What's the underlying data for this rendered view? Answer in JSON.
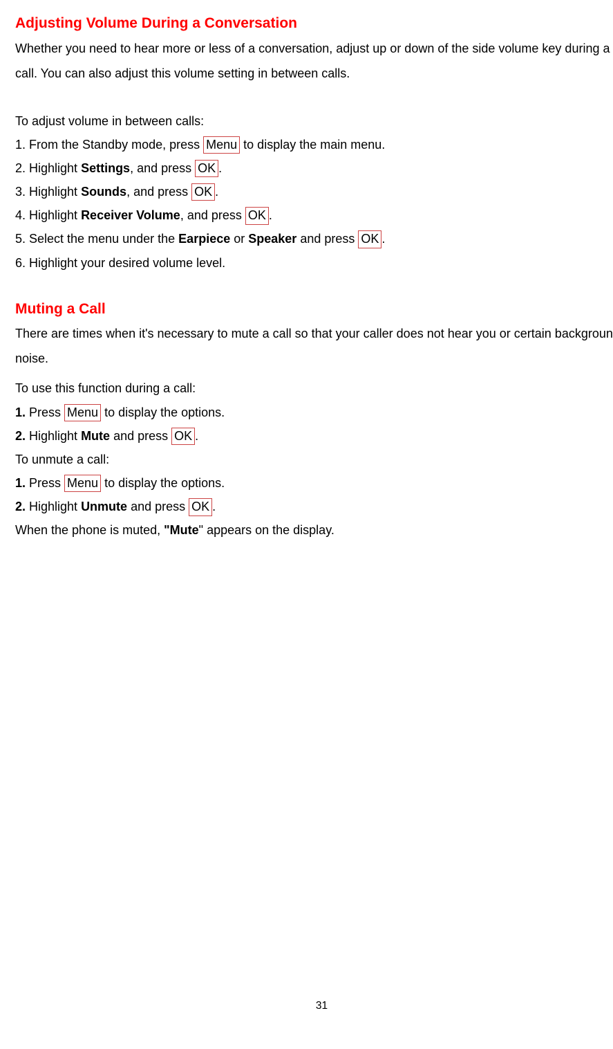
{
  "section1": {
    "heading": "Adjusting Volume During a Conversation",
    "intro": "Whether you need to hear more or less of a conversation, adjust up or down of the side volume key during a call. You can also adjust this volume setting in between calls.",
    "sub_intro": "To adjust volume in between calls:",
    "steps": {
      "s1a": "1. From the Standby mode, press ",
      "s1key": "Menu",
      "s1b": " to display the main menu.",
      "s2a": "2. Highlight ",
      "s2bold": "Settings",
      "s2b": ", and press ",
      "s2key": "OK",
      "s2c": ".",
      "s3a": "3. Highlight ",
      "s3bold": "Sounds",
      "s3b": ", and press ",
      "s3key": "OK",
      "s3c": ".",
      "s4n": "4.",
      "s4a": "   Highlight ",
      "s4bold": "Receiver Volume",
      "s4b": ", and press ",
      "s4key": "OK",
      "s4c": ".",
      "s5n": "5.",
      "s5a": "   Select the menu under the ",
      "s5bold1": "Earpiece",
      "s5mid": " or ",
      "s5bold2": "Speaker",
      "s5b": " and press ",
      "s5key": "OK",
      "s5c": ".",
      "s6n": "6.",
      "s6a": "   Highlight your desired volume level."
    }
  },
  "section2": {
    "heading": "Muting a Call",
    "intro": "There are times when it's necessary to mute a call so that your caller does not hear you or certain background noise.",
    "sub_intro1": "To use this function during a call:",
    "mute": {
      "s1n": "1.",
      "s1a": " Press ",
      "s1key": "Menu",
      "s1b": " to display the options.",
      "s2n": "2.",
      "s2a": " Highlight ",
      "s2bold": "Mute",
      "s2b": " and press ",
      "s2key": "OK",
      "s2c": "."
    },
    "sub_intro2": "To unmute a call:",
    "unmute": {
      "s1n": "1.",
      "s1a": " Press ",
      "s1key": "Menu",
      "s1b": " to display the options.",
      "s2n": "2.",
      "s2a": " Highlight ",
      "s2bold": "Unmute",
      "s2b": " and press ",
      "s2key": "OK",
      "s2c": "."
    },
    "footer_a": "When the phone is muted, ",
    "footer_bold": "\"Mute",
    "footer_b": "\" appears on the display."
  },
  "page_number": "31"
}
